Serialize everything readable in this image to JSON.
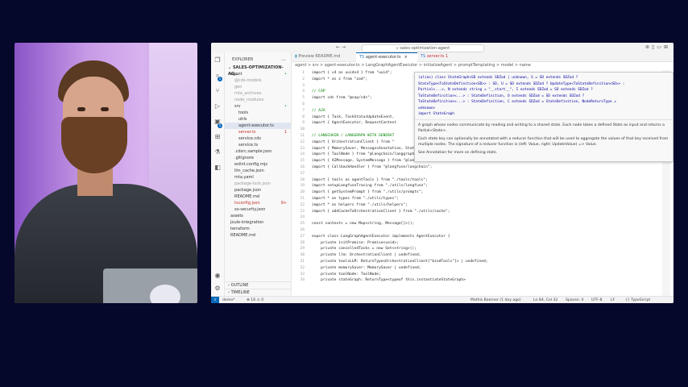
{
  "window": {
    "title": "sales-optimization-agent"
  },
  "activity_badges": {
    "scm": "1",
    "extensions": "5"
  },
  "sidebar": {
    "header": "EXPLORER",
    "more": "…",
    "project": "SALES-OPTIMIZATION-AG...",
    "tree": [
      {
        "label": "agent",
        "indent": 1,
        "marker": "•",
        "color": "#333"
      },
      {
        "label": "@cds-models",
        "indent": 2,
        "marker": "",
        "color": "#999"
      },
      {
        "label": "gen",
        "indent": 2,
        "marker": "",
        "color": "#999"
      },
      {
        "label": "mta_archives",
        "indent": 2,
        "marker": "",
        "color": "#999"
      },
      {
        "label": "node_modules",
        "indent": 2,
        "marker": "",
        "color": "#999"
      },
      {
        "label": "srv",
        "indent": 2,
        "marker": "•",
        "color": "#333"
      },
      {
        "label": "tools",
        "indent": 3,
        "marker": "",
        "color": "#333"
      },
      {
        "label": "utils",
        "indent": 3,
        "marker": "",
        "color": "#333"
      },
      {
        "label": "agent-executor.ts",
        "indent": 3,
        "marker": "",
        "color": "#333",
        "selected": true
      },
      {
        "label": "server.ts",
        "indent": 3,
        "marker": "1",
        "color": "#c72e2e"
      },
      {
        "label": "service.cds",
        "indent": 3,
        "marker": "",
        "color": "#333"
      },
      {
        "label": "service.ts",
        "indent": 3,
        "marker": "",
        "color": "#333"
      },
      {
        "label": ".cdsrc.sample.json",
        "indent": 2,
        "marker": "",
        "color": "#333"
      },
      {
        "label": ".gitignore",
        "indent": 2,
        "marker": "",
        "color": "#333"
      },
      {
        "label": "eslint.config.mjs",
        "indent": 2,
        "marker": "",
        "color": "#333"
      },
      {
        "label": "llm_cache.json",
        "indent": 2,
        "marker": "",
        "color": "#333"
      },
      {
        "label": "mta.yaml",
        "indent": 2,
        "marker": "",
        "color": "#333"
      },
      {
        "label": "package-lock.json",
        "indent": 2,
        "marker": "",
        "color": "#999"
      },
      {
        "label": "package.json",
        "indent": 2,
        "marker": "",
        "color": "#333"
      },
      {
        "label": "README.md",
        "indent": 2,
        "marker": "",
        "color": "#333"
      },
      {
        "label": "tsconfig.json",
        "indent": 2,
        "marker": "9+",
        "color": "#c72e2e"
      },
      {
        "label": "xs-security.json",
        "indent": 2,
        "marker": "",
        "color": "#333"
      },
      {
        "label": "assets",
        "indent": 1,
        "marker": "",
        "color": "#333"
      },
      {
        "label": "joule-integration",
        "indent": 1,
        "marker": "",
        "color": "#333"
      },
      {
        "label": "terraform",
        "indent": 1,
        "marker": "",
        "color": "#333"
      },
      {
        "label": "README.md",
        "indent": 1,
        "marker": "",
        "color": "#333"
      }
    ],
    "outline": "OUTLINE",
    "timeline": "TIMELINE"
  },
  "tabs": [
    {
      "label": "Preview README.md",
      "active": false,
      "color": "#666"
    },
    {
      "label": "agent-executor.ts",
      "active": true,
      "color": "#333",
      "close": "×"
    },
    {
      "label": "server.ts 1",
      "active": false,
      "color": "#c72e2e"
    }
  ],
  "breadcrumb": "agent > srv > agent-executor.ts > LangGraphAgentExecutor > initializeAgent > promptTemplating > model > name",
  "code_lines": [
    {
      "n": "1",
      "text": "import { v4 as uuidv4 } from \"uuid\";",
      "cls": ""
    },
    {
      "n": "2",
      "text": "import * as z from \"zod\";",
      "cls": ""
    },
    {
      "n": "3",
      "text": "",
      "cls": ""
    },
    {
      "n": "4",
      "text": "// CAP",
      "cls": "cm"
    },
    {
      "n": "5",
      "text": "import cds from \"@sap/cds\";",
      "cls": ""
    },
    {
      "n": "6",
      "text": "",
      "cls": ""
    },
    {
      "n": "7",
      "text": "// A2A",
      "cls": "cm"
    },
    {
      "n": "8",
      "text": "import { Task, TaskStatusUpdateEvent,",
      "cls": ""
    },
    {
      "n": "9",
      "text": "import { AgentExecutor, RequestContext",
      "cls": ""
    },
    {
      "n": "10",
      "text": "",
      "cls": ""
    },
    {
      "n": "11",
      "text": "// LANGCHAIN / LANGGRAPH WITH GENERAT",
      "cls": "cm"
    },
    {
      "n": "12",
      "text": "import { OrchestrationClient } from \"",
      "cls": ""
    },
    {
      "n": "13",
      "text": "import { MemorySaver, MessagesAnnotation, StateGraph } from \"@langchain/langgraph\";",
      "cls": ""
    },
    {
      "n": "14",
      "text": "import { ToolNode } from \"@langchain/langgraph/prebuilt\";",
      "cls": ""
    },
    {
      "n": "15",
      "text": "import { AIMessage, SystemMessage } from \"@langchain/core/messages\";",
      "cls": ""
    },
    {
      "n": "16",
      "text": "import { CallbackHandler } from \"@langfuse/langchain\";",
      "cls": ""
    },
    {
      "n": "17",
      "text": "",
      "cls": ""
    },
    {
      "n": "18",
      "text": "import { tools as agentTools } from \"./tools/tools\";",
      "cls": ""
    },
    {
      "n": "19",
      "text": "import setupLangfuseTracing from \"./utils/langfuse\";",
      "cls": ""
    },
    {
      "n": "20",
      "text": "import { getSystemPrompt } from \"./utils/prompts\";",
      "cls": ""
    },
    {
      "n": "21",
      "text": "import * as types from \"./utils/types\";",
      "cls": ""
    },
    {
      "n": "22",
      "text": "import * as helpers from \"./utils/helpers\";",
      "cls": ""
    },
    {
      "n": "23",
      "text": "import { addCacheToOrchestrationClient } from \"./utils/cache\";",
      "cls": ""
    },
    {
      "n": "24",
      "text": "",
      "cls": ""
    },
    {
      "n": "25",
      "text": "const contexts = new Map<string, Message[]>();",
      "cls": ""
    },
    {
      "n": "26",
      "text": "",
      "cls": ""
    },
    {
      "n": "27",
      "text": "export class LangGraphAgentExecutor implements AgentExecutor {",
      "cls": ""
    },
    {
      "n": "28",
      "text": "    private initPromise: Promise<void>;",
      "cls": ""
    },
    {
      "n": "29",
      "text": "    private cancelledTasks = new Set<string>();",
      "cls": ""
    },
    {
      "n": "30",
      "text": "    private llm: OrchestrationClient | undefined;",
      "cls": ""
    },
    {
      "n": "31",
      "text": "    private toolsLLM: ReturnType<OrchestrationClient[\"bindTools\"]> | undefined;",
      "cls": ""
    },
    {
      "n": "32",
      "text": "    private memorySaver: MemorySaver | undefined;",
      "cls": ""
    },
    {
      "n": "33",
      "text": "    private toolNode: ToolNode;",
      "cls": ""
    },
    {
      "n": "34",
      "text": "    private stateGraph: ReturnType<typeof this.instantiateStateGraph>",
      "cls": ""
    }
  ],
  "hover": {
    "signature": [
      "(alias) class StateGraph<SD extends SDZod | unknown, S = SD extends SDZod ?",
      "StateType<ToStateDefinition<SD>> : SD, U = SD extends SDZod ? UpdateType<ToStateDefinition<SD>> :",
      "Partial<...>, N extends string = \"__start__\", I extends SDZod = SD extends SDZod ?",
      "ToStateDefinition<...> : StateDefinition, O extends SDZod = SD extends SDZod ?",
      "ToStateDefinition<...> : StateDefinition, C extends SDZod = StateDefinition, NodeReturnType =",
      "unknown>",
      "import StateGraph"
    ],
    "desc1": "A graph whose nodes communicate by reading and writing to a shared state. Each node takes a defined State as input and returns a Partial<State>.",
    "desc2": "Each state key can optionally be annotated with a reducer function that will be used to aggregate the values of that key received from multiple nodes. The signature of a reducer function is (left: Value, right: UpdateValue) => Value.",
    "desc3": "See Annotation for more on defining state."
  },
  "status": {
    "branch": "demo*",
    "problems": "⊗ 16 ⚠ 0",
    "author": "Mathis Boerner (1 day ago)",
    "position": "Ln 84, Col 32",
    "spaces": "Spaces: 4",
    "encoding": "UTF-8",
    "eol": "LF",
    "language": "{} TypeScript"
  }
}
